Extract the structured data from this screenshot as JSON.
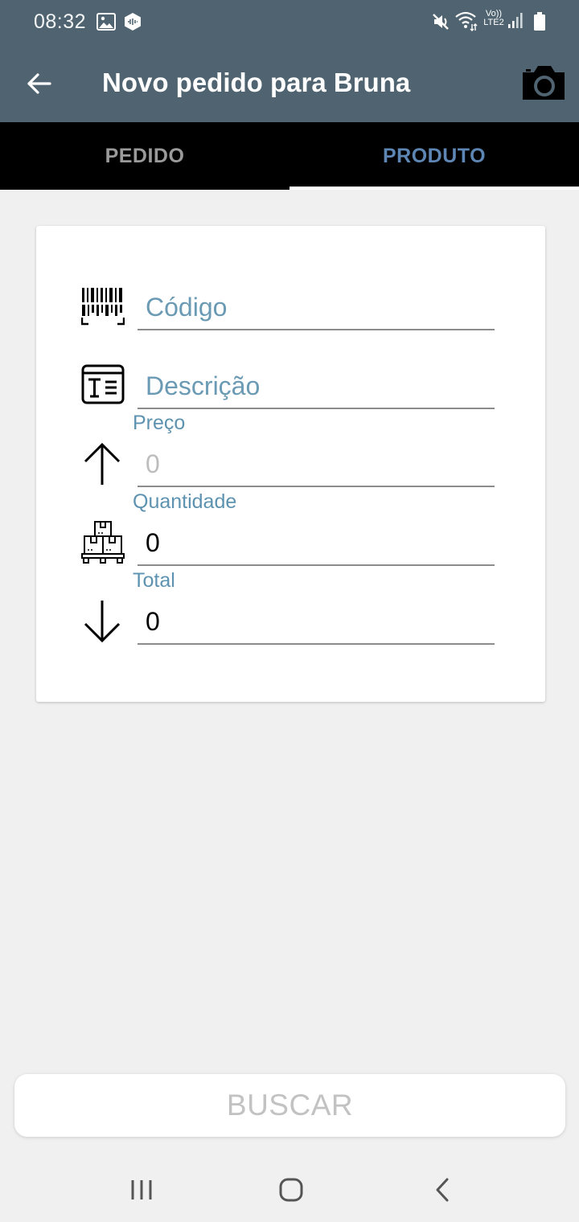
{
  "status_bar": {
    "time": "08:32",
    "left_icons": [
      "image-icon",
      "app-notification-icon"
    ],
    "right_icons": [
      "mute-icon",
      "wifi-icon",
      "volte-icon",
      "signal-icon",
      "battery-icon"
    ],
    "volte_line1": "Vo))",
    "volte_line2": "LTE2"
  },
  "app_bar": {
    "title": "Novo pedido para Bruna",
    "back_icon": "arrow-left-icon",
    "action_icon": "camera-icon"
  },
  "tabs": [
    {
      "label": "PEDIDO",
      "selected": false
    },
    {
      "label": "PRODUTO",
      "selected": true
    }
  ],
  "form": {
    "codigo": {
      "icon": "barcode-icon",
      "placeholder": "Código",
      "value": ""
    },
    "descricao": {
      "icon": "text-document-icon",
      "placeholder": "Descrição",
      "value": ""
    },
    "preco": {
      "icon": "arrow-up-icon",
      "label": "Preço",
      "value": "0"
    },
    "quantidade": {
      "icon": "boxes-pallet-icon",
      "label": "Quantidade",
      "value": "0"
    },
    "total": {
      "icon": "arrow-down-icon",
      "label": "Total",
      "value": "0"
    }
  },
  "buscar_label": "BUSCAR",
  "nav_bar": [
    "recent-apps-icon",
    "home-icon",
    "back-icon"
  ],
  "colors": {
    "app_bar": "#4f6470",
    "tab_bar": "#000000",
    "tab_selected": "#5d86b4",
    "tab_unselected": "#9a9a9a",
    "label": "#5d93b0",
    "background": "#f0f0f0"
  }
}
